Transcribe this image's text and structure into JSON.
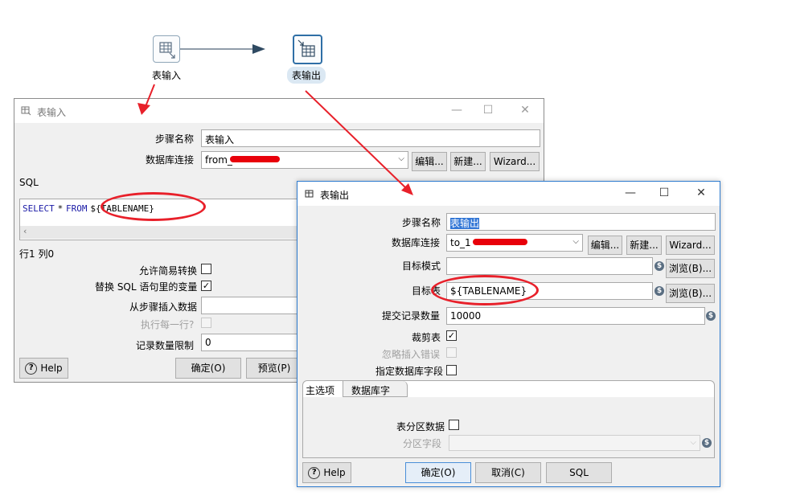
{
  "canvas": {
    "step_input_label": "表输入",
    "step_output_label": "表输出"
  },
  "input_dialog": {
    "title": "表输入",
    "step_name_label": "步骤名称",
    "step_name_value": "表输入",
    "db_conn_label": "数据库连接",
    "db_conn_value": "from_",
    "edit_button": "编辑...",
    "new_button": "新建...",
    "wizard_button": "Wizard...",
    "sql_label": "SQL",
    "sql_keyword_select": "SELECT",
    "sql_star": "*",
    "sql_keyword_from": "FROM",
    "sql_variable": "${TABLENAME}",
    "cursor_position": "行1 列0",
    "lazy_conversion_label": "允许简易转换",
    "replace_vars_label": "替换 SQL 语句里的变量",
    "insert_from_step_label": "从步骤插入数据",
    "execute_each_row_label": "执行每一行?",
    "limit_label": "记录数量限制",
    "limit_value": "0",
    "help_button": "Help",
    "ok_button": "确定(O)",
    "preview_button": "预览(P)"
  },
  "output_dialog": {
    "title": "表输出",
    "step_name_label": "步骤名称",
    "step_name_value": "表输出",
    "db_conn_label": "数据库连接",
    "db_conn_value": "to_1",
    "edit_button": "编辑...",
    "new_button": "新建...",
    "wizard_button": "Wizard...",
    "target_schema_label": "目标模式",
    "target_schema_value": "",
    "browse_button": "浏览(B)...",
    "target_table_label": "目标表",
    "target_table_value": "${TABLENAME}",
    "commit_size_label": "提交记录数量",
    "commit_size_value": "10000",
    "truncate_label": "裁剪表",
    "ignore_errors_label": "忽略插入错误",
    "specify_fields_label": "指定数据库字段",
    "tab_main": "主选项",
    "tab_fields": "数据库字段",
    "partition_label": "表分区数据",
    "partition_field_label": "分区字段",
    "help_button": "Help",
    "ok_button": "确定(O)",
    "cancel_button": "取消(C)",
    "sql_button": "SQL"
  },
  "colors": {
    "annotation_red": "#e8202a",
    "active_border": "#2e7bcf",
    "sql_keyword": "#1a1aa6"
  }
}
